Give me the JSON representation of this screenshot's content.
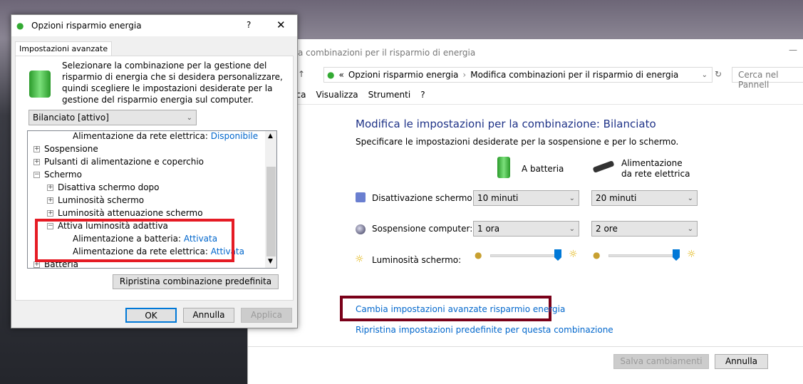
{
  "main": {
    "title": "a combinazioni per il risparmio di energia",
    "breadcrumb": [
      "Opzioni risparmio energia",
      "Modifica combinazioni per il risparmio di energia"
    ],
    "search_placeholder": "Cerca nel Pannell",
    "menu": [
      "fica",
      "Visualizza",
      "Strumenti",
      "?"
    ],
    "heading": "Modifica le impostazioni per la combinazione: Bilanciato",
    "subheading": "Specificare le impostazioni desiderate per la sospensione e per lo schermo.",
    "col_battery": "A batteria",
    "col_ac": "Alimentazione da rete elettrica",
    "rows": [
      {
        "label": "Disattivazione schermo:",
        "battery": "10 minuti",
        "ac": "20 minuti"
      },
      {
        "label": "Sospensione computer:",
        "battery": "1 ora",
        "ac": "2 ore"
      }
    ],
    "brightness_label": "Luminosità schermo:",
    "brightness_battery_pct": 100,
    "brightness_ac_pct": 100,
    "link_advanced": "Cambia impostazioni avanzate risparmio energia",
    "link_restore": "Ripristina impostazioni predefinite per questa combinazione",
    "save": "Salva cambiamenti",
    "cancel": "Annulla",
    "highlight_color": "#7a0019"
  },
  "dialog": {
    "title": "Opzioni risparmio energia",
    "help": "?",
    "tab": "Impostazioni avanzate",
    "description": "Selezionare la combinazione per la gestione del risparmio di energia che si desidera personalizzare, quindi scegliere le impostazioni desiderate per la gestione del risparmio energia sul computer.",
    "plan": "Bilanciato [attivo]",
    "tree": {
      "r0": {
        "label": "Alimentazione da rete elettrica:",
        "value": "Disponibile"
      },
      "r1": "Sospensione",
      "r2": "Pulsanti di alimentazione e coperchio",
      "r3": "Schermo",
      "r4": "Disattiva schermo dopo",
      "r5": "Luminosità schermo",
      "r6": "Luminosità attenuazione schermo",
      "r7": "Attiva luminosità adattiva",
      "r8": {
        "label": "Alimentazione a batteria:",
        "value": "Attivata"
      },
      "r9": {
        "label": "Alimentazione da rete elettrica:",
        "value": "Attivata"
      },
      "r10": "Batteria"
    },
    "restore": "Ripristina combinazione predefinita",
    "ok": "OK",
    "cancel": "Annulla",
    "apply": "Applica",
    "highlight_color": "#e51b24"
  }
}
